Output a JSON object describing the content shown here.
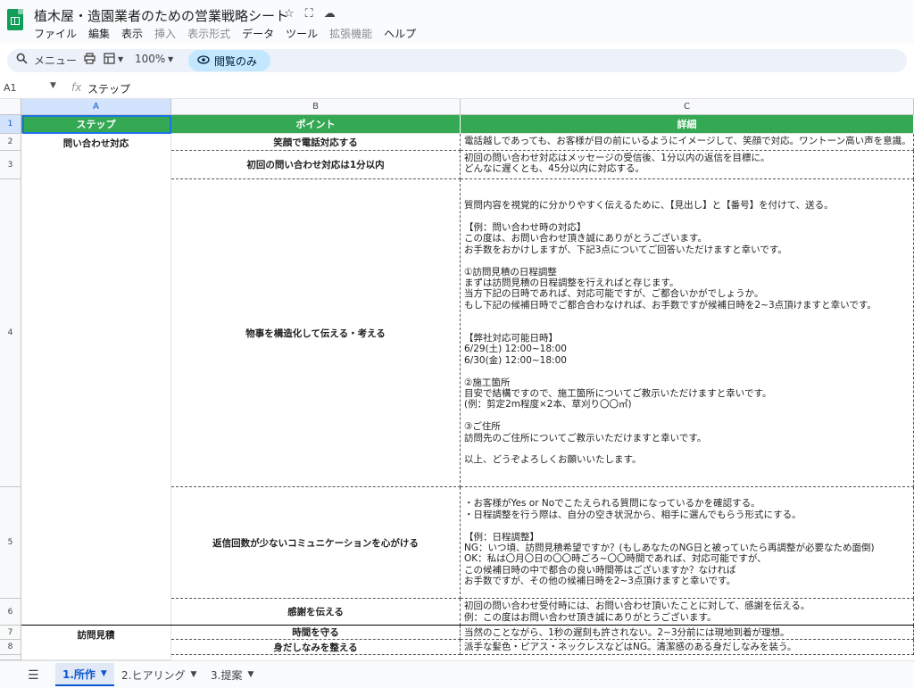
{
  "doc": {
    "title": "植木屋・造園業者のための営業戦略シート",
    "icons": [
      "star-icon",
      "move-to-drive-icon",
      "cloud-status-icon"
    ]
  },
  "menu": [
    "ファイル",
    "編集",
    "表示",
    "挿入",
    "表示形式",
    "データ",
    "ツール",
    "拡張機能",
    "ヘルプ"
  ],
  "menu_disabled": [
    "挿入",
    "表示形式",
    "拡張機能"
  ],
  "toolbar": {
    "menu_label": "メニュー",
    "zoom": "100%",
    "view_only": "閲覧のみ"
  },
  "formula_bar": {
    "cell_ref": "A1",
    "fx": "fx",
    "content": "ステップ"
  },
  "columns": [
    "A",
    "B",
    "C"
  ],
  "rows": [
    "1",
    "2",
    "3",
    "4",
    "5",
    "6",
    "7",
    "8"
  ],
  "grid": {
    "header": {
      "step": "ステップ",
      "point": "ポイント",
      "detail": "詳細"
    },
    "steps": {
      "inquiry": "問い合わせ対応",
      "visit": "訪問見積"
    },
    "points": [
      "笑顔で電話対応する",
      "初回の問い合わせ対応は1分以内",
      "物事を構造化して伝える・考える",
      "返信回数が少ないコミュニケーションを心がける",
      "感謝を伝える",
      "時間を守る",
      "身だしなみを整える"
    ],
    "details": [
      "電話越しであっても、お客様が目の前にいるようにイメージして、笑顔で対応。ワントーン高い声を意識。",
      "初回の問い合わせ対応はメッセージの受信後、1分以内の返信を目標に。\nどんなに遅くとも、45分以内に対応する。",
      "質問内容を視覚的に分かりやすく伝えるために、【見出し】と【番号】を付けて、送る。\n\n【例：問い合わせ時の対応】\nこの度は、お問い合わせ頂き誠にありがとうございます。\nお手数をおかけしますが、下記3点についてご回答いただけますと幸いです。\n\n①訪問見積の日程調整\nまずは訪問見積の日程調整を行えればと存じます。\n当方下記の日時であれば、対応可能ですが、ご都合いかがでしょうか。\nもし下記の候補日時でご都合合わなければ、お手数ですが候補日時を2~3点頂けますと幸いです。\n\n\n【弊社対応可能日時】\n6/29(土) 12:00~18:00\n6/30(金) 12:00~18:00\n\n②施工箇所\n目安で結構ですので、施工箇所についてご教示いただけますと幸いです。\n(例：剪定2m程度×2本、草刈り〇〇㎡)\n\n③ご住所\n訪問先のご住所についてご教示いただけますと幸いです。\n\n以上、どうぞよろしくお願いいたします。",
      "・お客様がYes or Noでこたえられる質問になっているかを確認する。\n・日程調整を行う際は、自分の空き状況から、相手に選んでもらう形式にする。\n\n【例：日程調整】\nNG：いつ頃、訪問見積希望ですか？(もしあなたのNG日と被っていたら再調整が必要なため面倒)\nOK：私は〇月〇日の〇〇時ごろ~〇〇時間であれば、対応可能ですが、\nこの候補日時の中で都合の良い時間帯はございますか？なければ\nお手数ですが、その他の候補日時を2~3点頂けますと幸いです。",
      "初回の問い合わせ受付時には、お問い合わせ頂いたことに対して、感謝を伝える。\n例：この度はお問い合わせ頂き誠にありがとうございます。",
      "当然のことながら、1秒の遅刻も許されない。2~3分前には現地到着が理想。",
      "派手な髪色・ピアス・ネックレスなどはNG。清潔感のある身だしなみを装う。"
    ]
  },
  "sheets": [
    "1.所作",
    "2.ヒアリング",
    "3.提案"
  ],
  "active_sheet": "1.所作",
  "colors": {
    "header_green": "#34a853",
    "selection_blue": "#1a73e8",
    "view_only_bg": "#c2e7ff"
  }
}
